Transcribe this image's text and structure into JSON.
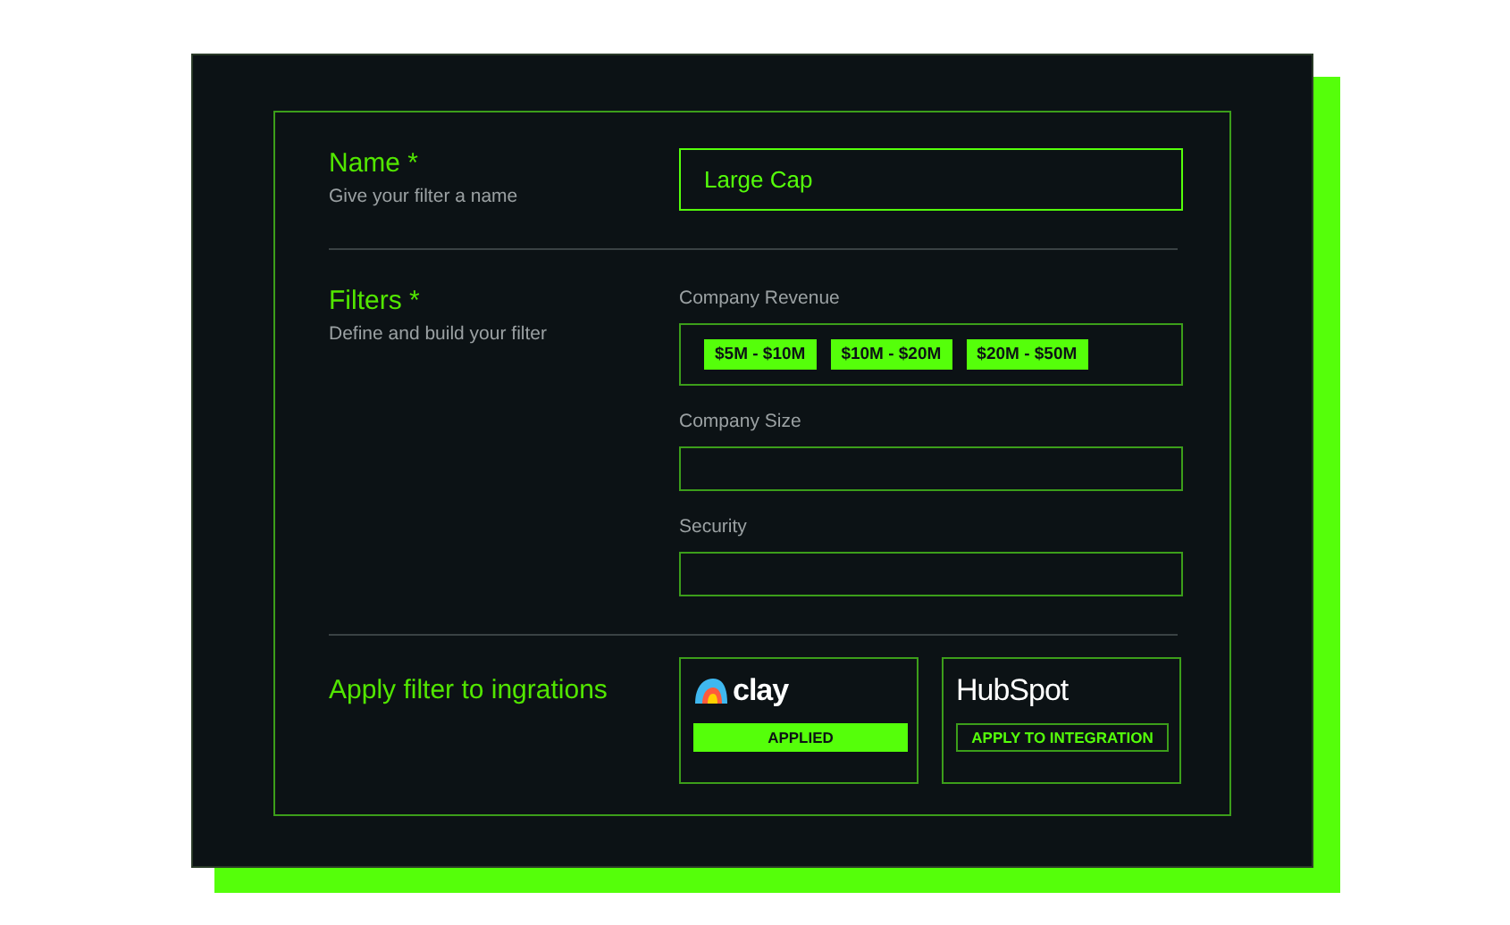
{
  "name_section": {
    "title": "Name *",
    "hint": "Give your filter a name",
    "value": "Large Cap"
  },
  "filters_section": {
    "title": "Filters *",
    "hint": "Define and build your filter",
    "fields": [
      {
        "label": "Company Revenue",
        "tags": [
          "$5M - $10M",
          "$10M - $20M",
          "$20M - $50M"
        ]
      },
      {
        "label": "Company Size"
      },
      {
        "label": "Security"
      }
    ]
  },
  "integrations_section": {
    "title": "Apply filter to ingrations",
    "integrations": [
      {
        "kind": "clay",
        "logo_text": "clay",
        "button": "APPLIED",
        "applied": true
      },
      {
        "kind": "hubspot",
        "logo_text": "HubSpot",
        "button": "APPLY TO INTEGRATION",
        "applied": false
      }
    ]
  }
}
